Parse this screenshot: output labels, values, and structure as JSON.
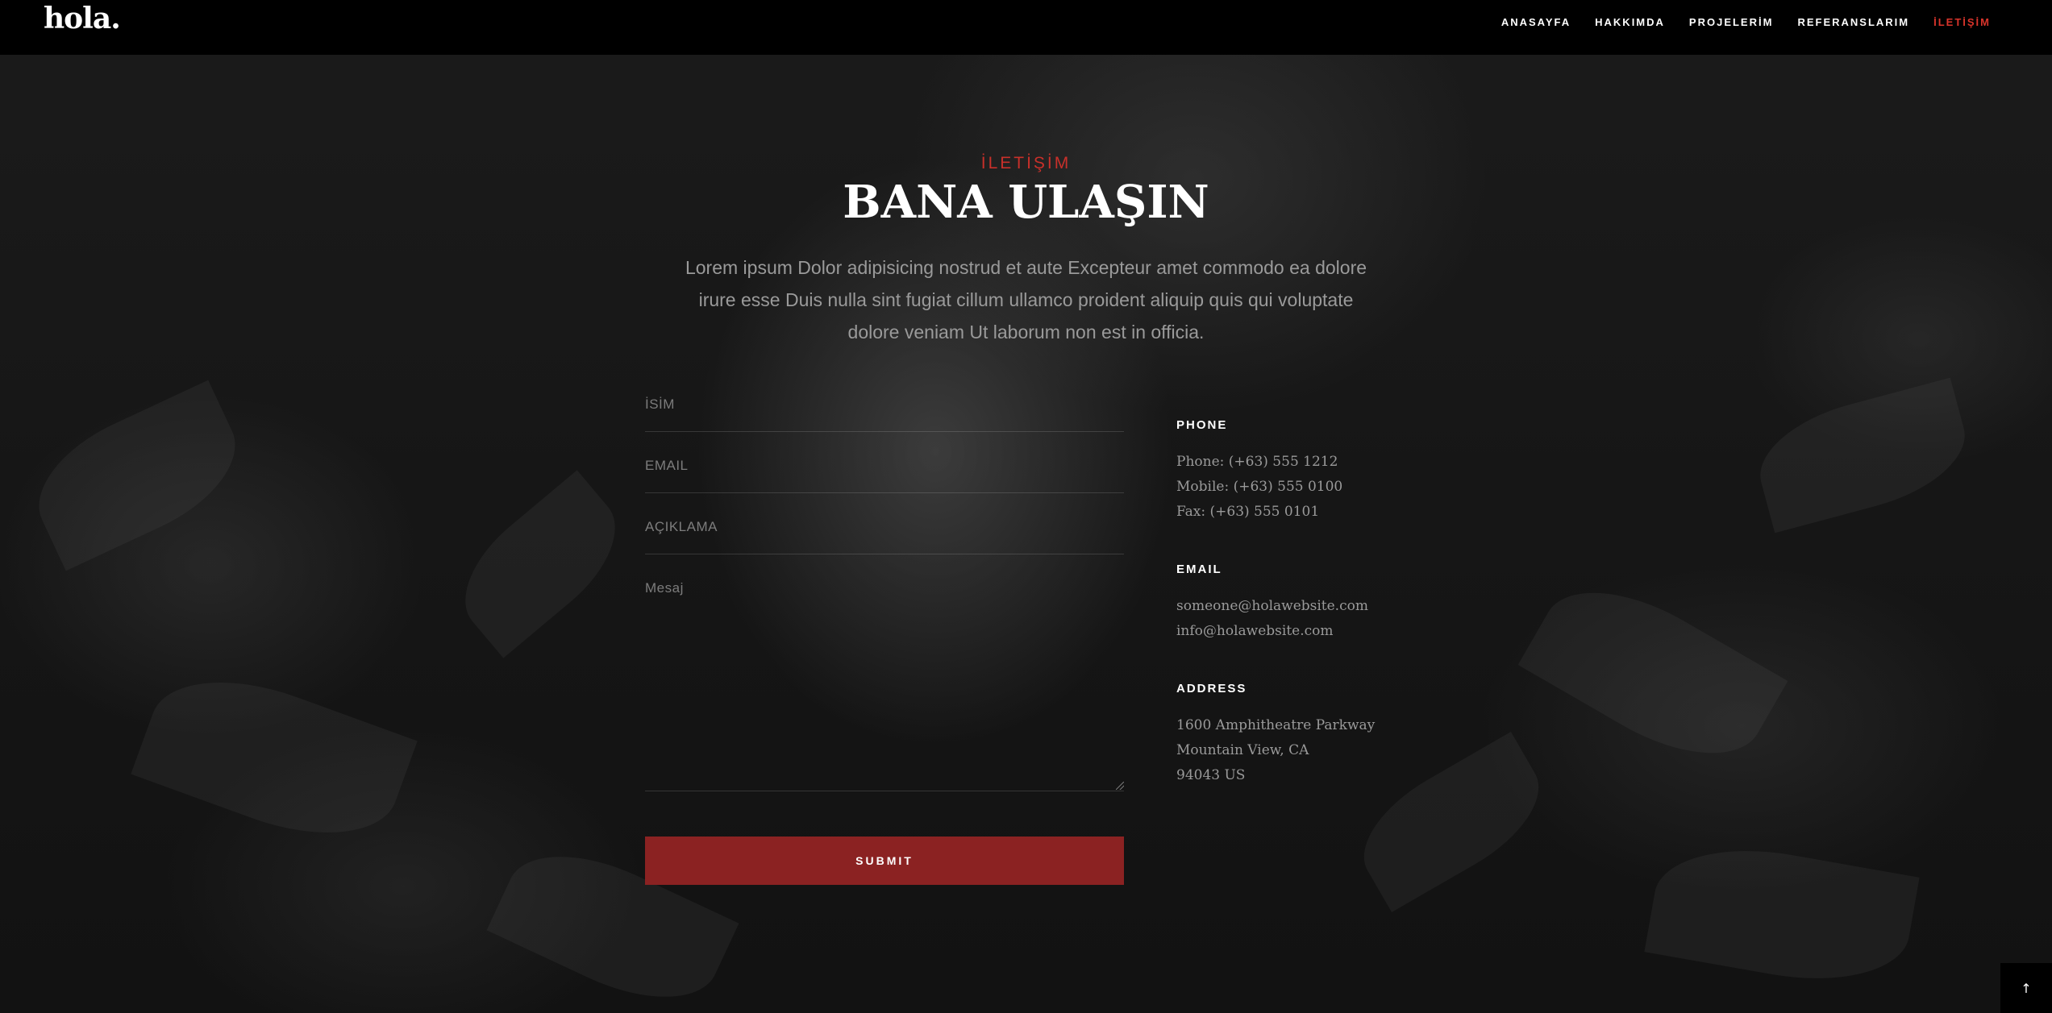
{
  "header": {
    "logo": "hola.",
    "nav": [
      "ANASAYFA",
      "HAKKIMDA",
      "PROJELERİM",
      "REFERANSLARIM",
      "İLETİŞİM"
    ]
  },
  "section": {
    "eyebrow": "İLETİŞİM",
    "title": "BANA ULAŞIN",
    "intro": "Lorem ipsum Dolor adipisicing nostrud et aute Excepteur amet commodo ea dolore irure esse Duis nulla sint fugiat cillum ullamco proident aliquip quis qui voluptate dolore veniam Ut laborum non est in officia."
  },
  "form": {
    "name_placeholder": "İSİM",
    "email_placeholder": "EMAIL",
    "description_placeholder": "AÇIKLAMA",
    "message_placeholder": "Mesaj",
    "submit_label": "SUBMIT"
  },
  "contact": {
    "phone_heading": "PHONE",
    "phone_lines": [
      "Phone: (+63) 555 1212",
      "Mobile: (+63) 555 0100",
      "Fax: (+63) 555 0101"
    ],
    "email_heading": "EMAIL",
    "email_lines": [
      "someone@holawebsite.com",
      "info@holawebsite.com"
    ],
    "address_heading": "ADDRESS",
    "address_lines": [
      "1600 Amphitheatre Parkway",
      "Mountain View, CA",
      "94043 US"
    ]
  },
  "back_to_top_icon": "arrow-up-icon",
  "colors": {
    "accent": "#c8302a",
    "submit_bg": "#8b2222",
    "header_bg": "#000000"
  }
}
